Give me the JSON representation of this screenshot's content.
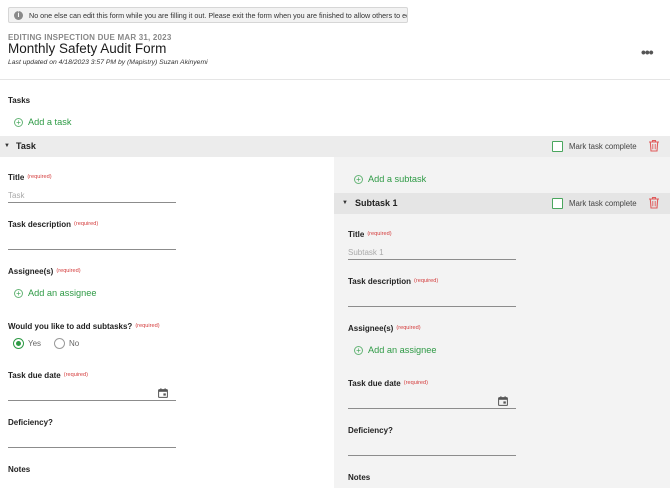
{
  "banner": {
    "text": "No one else can edit this form while you are filling it out. Please exit the form when you are finished to allow others to edit.",
    "info_icon": "i",
    "close_icon": "×"
  },
  "header": {
    "overline": "EDITING INSPECTION DUE MAR 31, 2023",
    "title": "Monthly Safety Audit Form",
    "updated": "Last updated on 4/18/2023 3:57 PM by (Mapistry) Suzan Akinyemi",
    "more_icon": "•••"
  },
  "tasks": {
    "label": "Tasks",
    "add_task": "Add a task",
    "plus": "+"
  },
  "task": {
    "caret": "▼",
    "title": "Task",
    "mark_complete": "Mark task complete",
    "required": "(required)",
    "fields": {
      "title_label": "Title",
      "title_placeholder": "Task",
      "description_label": "Task description",
      "assignees_label": "Assignee(s)",
      "add_assignee": "Add an assignee",
      "subtasks_question": "Would you like to add subtasks?",
      "yes": "Yes",
      "no": "No",
      "subtasks_selected": "Yes",
      "due_date_label": "Task due date",
      "deficiency_label": "Deficiency?",
      "notes_label": "Notes"
    }
  },
  "subtask": {
    "add_subtask": "Add a subtask",
    "caret": "▼",
    "title": "Subtask 1",
    "mark_complete": "Mark task complete",
    "required": "(required)",
    "fields": {
      "title_label": "Title",
      "title_placeholder": "Subtask 1",
      "description_label": "Task description",
      "assignees_label": "Assignee(s)",
      "add_assignee": "Add an assignee",
      "due_date_label": "Task due date",
      "deficiency_label": "Deficiency?",
      "notes_label": "Notes"
    }
  },
  "colors": {
    "accent": "#2e9a45",
    "required": "#d43c3c",
    "delete": "#e05a5a"
  }
}
